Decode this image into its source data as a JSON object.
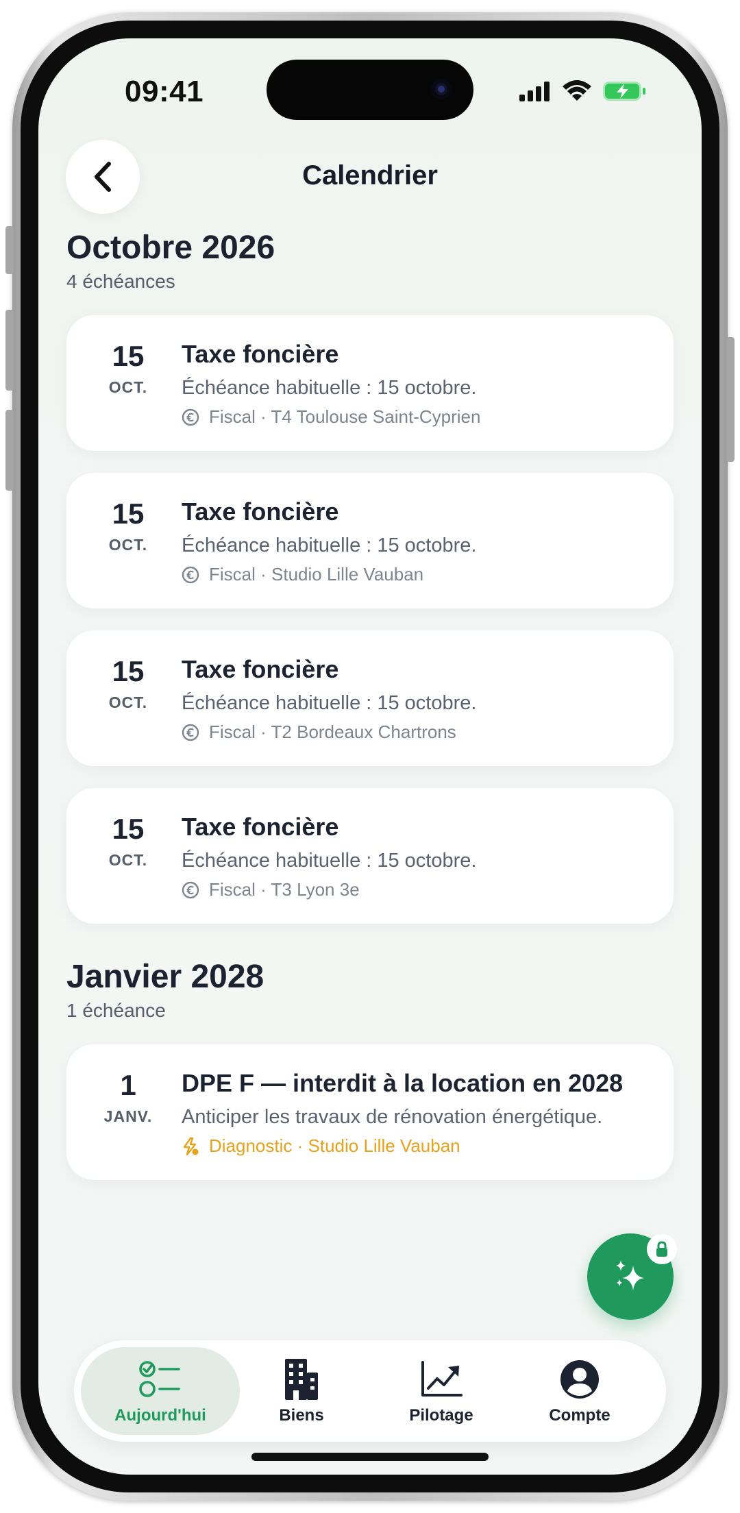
{
  "status_bar": {
    "time": "09:41"
  },
  "header": {
    "back_icon": "chevron-left-icon",
    "title": "Calendrier"
  },
  "sections": [
    {
      "title": "Octobre 2026",
      "subtitle": "4 échéances",
      "items": [
        {
          "day": "15",
          "month": "OCT.",
          "title": "Taxe foncière",
          "description": "Échéance habituelle : 15 octobre.",
          "meta": "Fiscal · T4 Toulouse Saint-Cyprien",
          "meta_icon": "euro-circle-icon"
        },
        {
          "day": "15",
          "month": "OCT.",
          "title": "Taxe foncière",
          "description": "Échéance habituelle : 15 octobre.",
          "meta": "Fiscal · Studio Lille Vauban",
          "meta_icon": "euro-circle-icon"
        },
        {
          "day": "15",
          "month": "OCT.",
          "title": "Taxe foncière",
          "description": "Échéance habituelle : 15 octobre.",
          "meta": "Fiscal · T2 Bordeaux Chartrons",
          "meta_icon": "euro-circle-icon"
        },
        {
          "day": "15",
          "month": "OCT.",
          "title": "Taxe foncière",
          "description": "Échéance habituelle : 15 octobre.",
          "meta": "Fiscal · T3 Lyon 3e",
          "meta_icon": "euro-circle-icon"
        }
      ]
    },
    {
      "title": "Janvier 2028",
      "subtitle": "1 échéance",
      "items": [
        {
          "day": "1",
          "month": "JANV.",
          "title": "DPE F — interdit à la location en 2028",
          "description": "Anticiper les travaux de rénovation énergétique.",
          "meta": "Diagnostic · Studio Lille Vauban",
          "meta_icon": "energy-icon",
          "meta_color": "#e8a21a"
        }
      ]
    }
  ],
  "fab": {
    "icon": "sparkles-icon",
    "badge_icon": "lock-icon"
  },
  "tabbar": {
    "tabs": [
      {
        "label": "Aujourd'hui",
        "icon": "checklist-icon",
        "active": true
      },
      {
        "label": "Biens",
        "icon": "building-icon",
        "active": false
      },
      {
        "label": "Pilotage",
        "icon": "chart-icon",
        "active": false
      },
      {
        "label": "Compte",
        "icon": "account-icon",
        "active": false
      }
    ]
  },
  "colors": {
    "accent": "#1f9a5c",
    "warning": "#e8a21a",
    "text": "#1c2230",
    "background": "#f3f6f4"
  }
}
